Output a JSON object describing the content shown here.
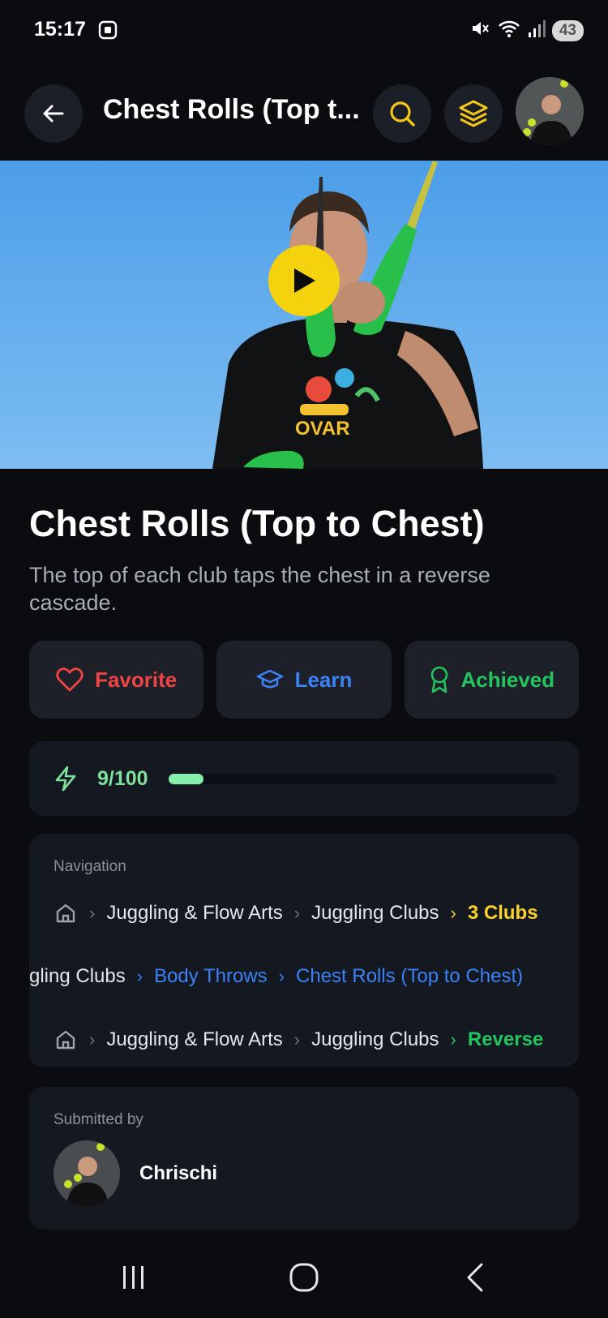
{
  "status_bar": {
    "time": "15:17",
    "network": "6",
    "battery": "43"
  },
  "header": {
    "title": "Chest Rolls (Top t..."
  },
  "video": {
    "state": "paused"
  },
  "trick": {
    "title": "Chest Rolls (Top to Chest)",
    "description": "The top of each club taps the chest in a reverse cascade."
  },
  "actions": {
    "favorite": "Favorite",
    "learn": "Learn",
    "achieved": "Achieved"
  },
  "progress": {
    "label": "9/100",
    "value": 9,
    "max": 100
  },
  "navigation": {
    "label": "Navigation",
    "rows": [
      {
        "items": [
          "Juggling & Flow Arts",
          "Juggling Clubs",
          "3 Clubs"
        ]
      },
      {
        "items": [
          "gling Clubs",
          "Body Throws",
          "Chest Rolls (Top to Chest)"
        ]
      },
      {
        "items": [
          "Juggling & Flow Arts",
          "Juggling Clubs",
          "Reverse"
        ]
      }
    ]
  },
  "submitted": {
    "label": "Submitted by",
    "name": "Chrischi"
  },
  "colors": {
    "accent_yellow": "#fbd22b",
    "favorite_red": "#ef4444",
    "learn_blue": "#3b82f6",
    "achieved_green": "#22c55e",
    "progress_green": "#86efac"
  }
}
